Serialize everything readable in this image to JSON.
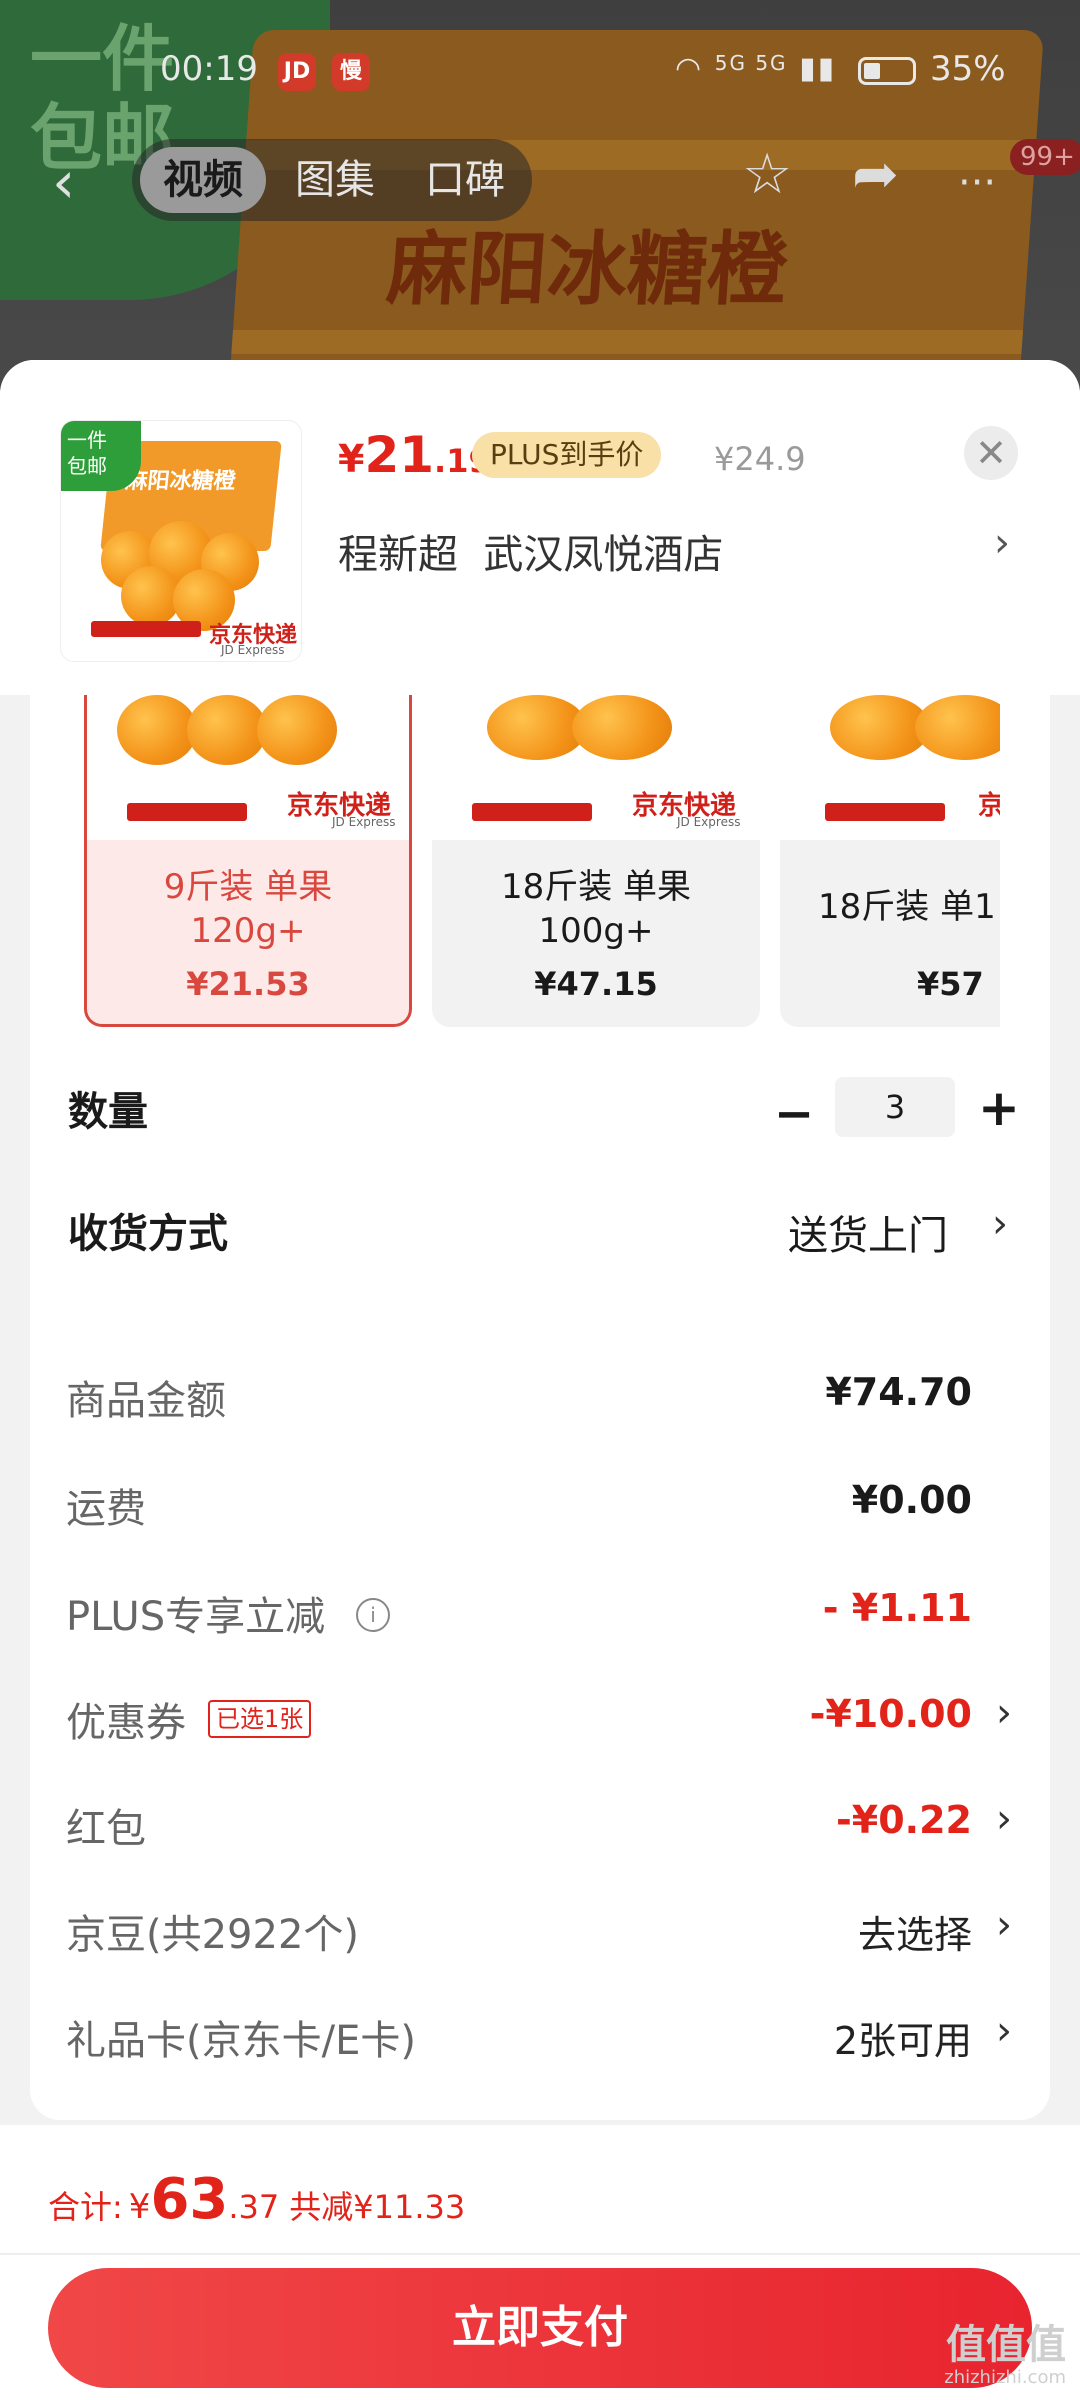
{
  "status_bar": {
    "time": "00:19",
    "app_icon_1": "JD",
    "app_icon_2": "慢",
    "signal": "5G 5G",
    "battery": "35%"
  },
  "background": {
    "promo_tag": "一件\n包邮",
    "box_title": "麻阳冰糖橙"
  },
  "nav": {
    "tabs": [
      {
        "label": "视频",
        "active": true
      },
      {
        "label": "图集"
      },
      {
        "label": "口碑"
      }
    ],
    "badge": "99+"
  },
  "product": {
    "thumb_ribbon": "一件\n包邮",
    "thumb_brand": "京东快递",
    "thumb_brand_sub": "JD Express",
    "thumb_box": "麻阳冰糖橙",
    "price_currency": "¥",
    "price_int": "21",
    "price_dec": ".19",
    "plus_tag": "PLUS到手价",
    "original_price": "¥24.9",
    "address": "程新超  武汉凤悦酒店"
  },
  "options": [
    {
      "name": "9斤装 单果\n120g+",
      "price": "¥21.53",
      "selected": true,
      "brand": "京东快递",
      "brand_sub": "JD Express"
    },
    {
      "name": "18斤装 单果\n100g+",
      "price": "¥47.15",
      "brand": "京东快递",
      "brand_sub": "JD Express"
    },
    {
      "name": "18斤装 单1",
      "price": "¥57",
      "brand": "京",
      "brand_sub": ""
    }
  ],
  "quantity": {
    "label": "数量",
    "value": "3",
    "minus": "−",
    "plus": "+"
  },
  "delivery": {
    "label": "收货方式",
    "value": "送货上门"
  },
  "summary": {
    "goods": {
      "label": "商品金额",
      "value": "¥74.70"
    },
    "shipping": {
      "label": "运费",
      "value": "¥0.00"
    },
    "plus_discount": {
      "label": "PLUS专享立减",
      "value": "- ¥1.11"
    },
    "coupon": {
      "label": "优惠券",
      "tag": "已选1张",
      "value": "-¥10.00"
    },
    "red_packet": {
      "label": "红包",
      "value": "-¥0.22"
    },
    "jd_beans": {
      "label": "京豆(共2922个)",
      "value": "去选择"
    },
    "gift_card": {
      "label": "礼品卡(京东卡/E卡)",
      "value": "2张可用"
    }
  },
  "footer": {
    "total_label": "合计:",
    "total_currency": "¥",
    "total_int": "63",
    "total_dec": ".37",
    "total_saved": "共减¥11.33",
    "pay_button": "立即支付"
  },
  "watermark": {
    "main": "值值值",
    "sub": "zhizhizhi.com"
  },
  "colors": {
    "accent_red": "#e2231a",
    "plus_gold": "#f8e0a6",
    "selected_bg": "#fde9e7"
  }
}
